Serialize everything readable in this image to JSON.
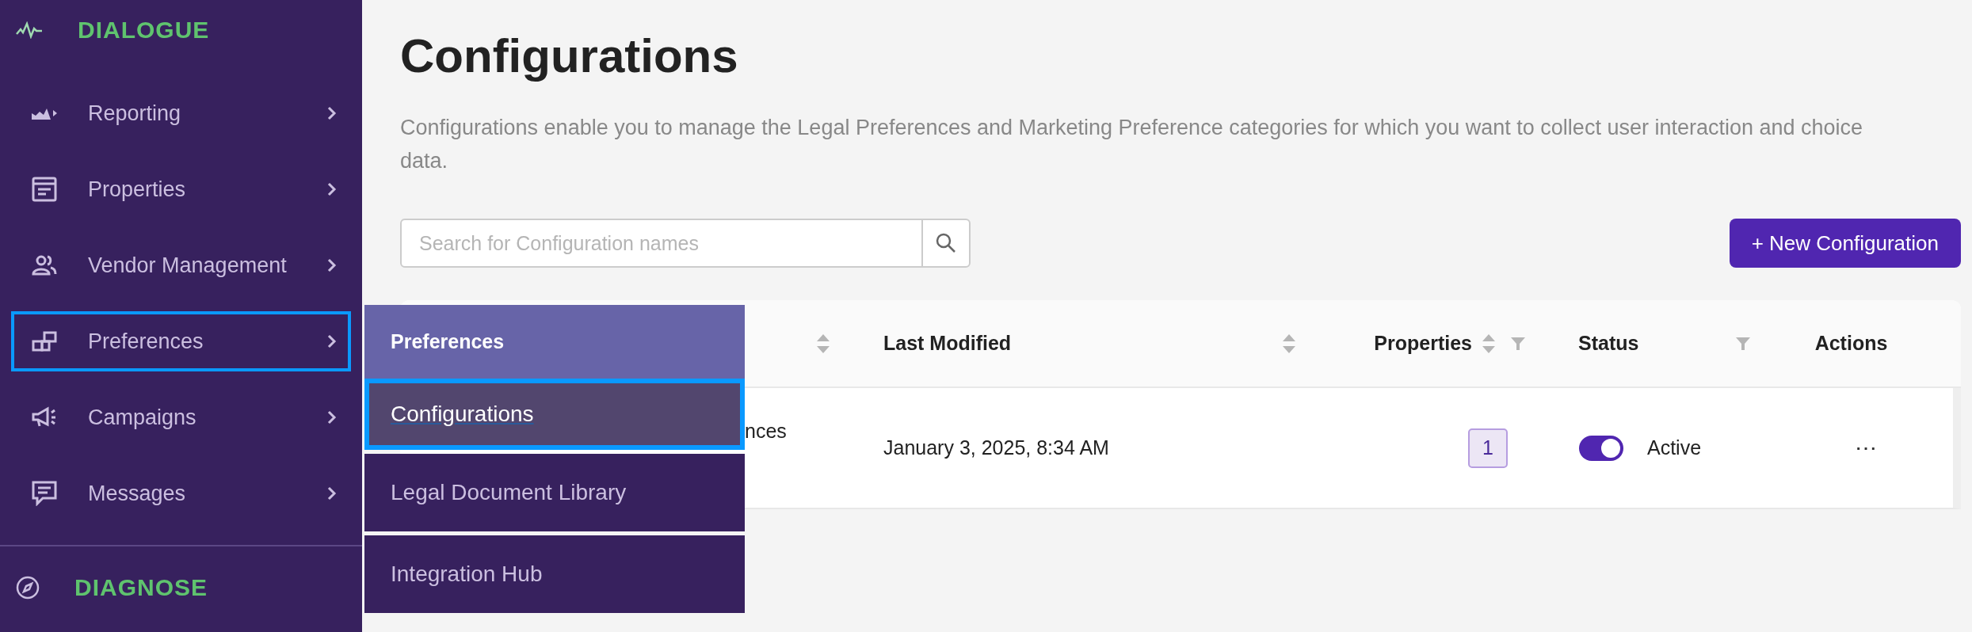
{
  "sidebar": {
    "header": {
      "label": "DIALOGUE"
    },
    "items": [
      {
        "label": "Reporting",
        "selected": false
      },
      {
        "label": "Properties",
        "selected": false
      },
      {
        "label": "Vendor Management",
        "selected": false
      },
      {
        "label": "Preferences",
        "selected": true
      },
      {
        "label": "Campaigns",
        "selected": false
      },
      {
        "label": "Messages",
        "selected": false
      }
    ],
    "footer": {
      "label": "DIAGNOSE"
    }
  },
  "submenu": {
    "title": "Preferences",
    "items": [
      {
        "label": "Configurations",
        "selected": true
      },
      {
        "label": "Legal Document Library",
        "selected": false
      },
      {
        "label": "Integration Hub",
        "selected": false
      }
    ]
  },
  "page": {
    "title": "Configurations",
    "description": "Configurations enable you to manage the Legal Preferences and Marketing Preference categories for which you want to collect user interaction and choice data.",
    "search": {
      "placeholder": "Search for Configuration names"
    },
    "new_button": "+ New Configuration"
  },
  "table": {
    "columns": [
      {
        "sortable": true,
        "filterable": false
      },
      {
        "label": "Last Modified",
        "sortable": true,
        "filterable": false
      },
      {
        "label": "Properties",
        "sortable": true,
        "filterable": true
      },
      {
        "label": "Status",
        "sortable": false,
        "filterable": true
      },
      {
        "label": "Actions",
        "sortable": false,
        "filterable": false
      }
    ],
    "rows": [
      {
        "name": "nces",
        "last_modified": "January 3, 2025, 8:34 AM",
        "properties": "1",
        "status": {
          "on": true,
          "label": "Active"
        },
        "actions": "⋯"
      }
    ]
  }
}
